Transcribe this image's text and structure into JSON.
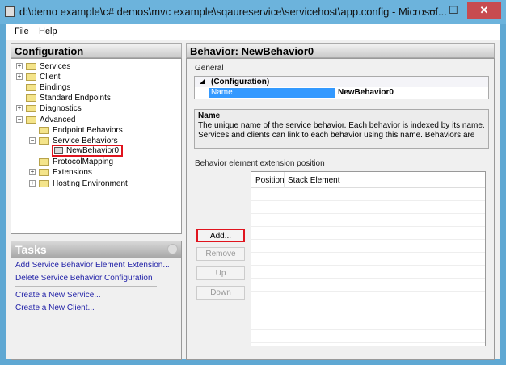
{
  "window": {
    "title": "d:\\demo example\\c# demos\\mvc example\\sqaureservice\\servicehost\\app.config - Microsof...",
    "minimize": "‒",
    "maximize": "☐",
    "close": "✕"
  },
  "menu": {
    "file": "File",
    "help": "Help"
  },
  "config_panel": {
    "title": "Configuration",
    "tree": [
      "Services",
      "Client",
      "Bindings",
      "Standard Endpoints",
      "Diagnostics",
      "Advanced",
      "Endpoint Behaviors",
      "Service Behaviors",
      "NewBehavior0",
      "ProtocolMapping",
      "Extensions",
      "Hosting Environment"
    ]
  },
  "tasks": {
    "title": "Tasks",
    "items": [
      "Add Service Behavior Element Extension...",
      "Delete Service Behavior Configuration",
      "Create a New Service...",
      "Create a New Client..."
    ]
  },
  "behavior_panel": {
    "title": "Behavior: NewBehavior0",
    "general_label": "General",
    "category": "(Configuration)",
    "prop_name": "Name",
    "prop_value": "NewBehavior0",
    "desc_title": "Name",
    "desc_text": "The unique name of the service behavior. Each behavior is indexed by its name. Services and clients can link to each behavior using this name. Behaviors are defined in the <servi...",
    "ext_label": "Behavior element extension position",
    "columns": [
      "Position",
      "Stack Element"
    ],
    "buttons": {
      "add": "Add...",
      "remove": "Remove",
      "up": "Up",
      "down": "Down"
    }
  },
  "colors": {
    "highlight": "#3399ff",
    "callout": "#e0141e",
    "link": "#2323a8"
  }
}
